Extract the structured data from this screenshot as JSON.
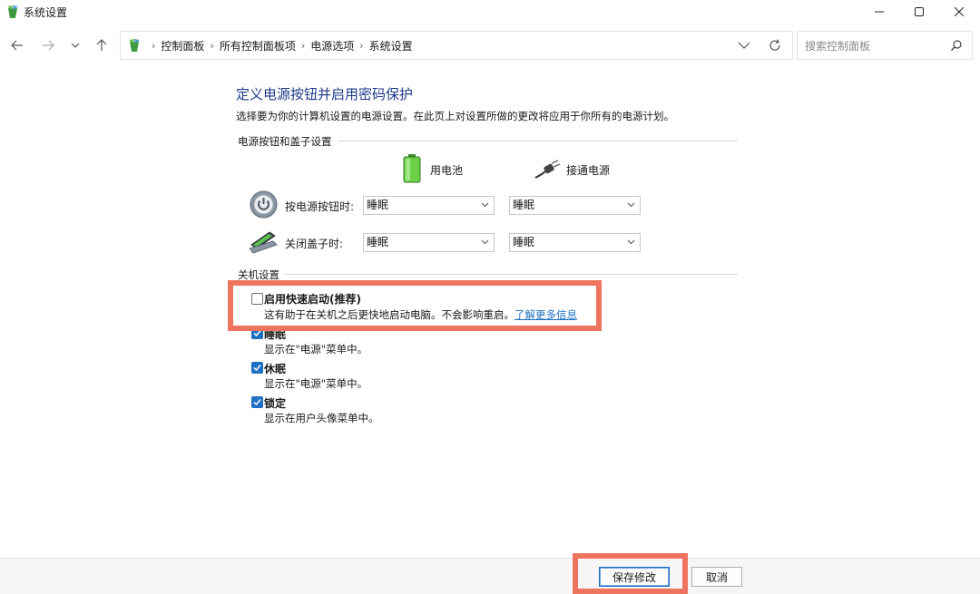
{
  "window": {
    "title": "系统设置",
    "controls": {
      "minimize": "minimize-icon",
      "maximize": "maximize-icon",
      "close": "close-icon"
    }
  },
  "nav": {
    "back_icon": "back-arrow-icon",
    "forward_icon": "forward-arrow-icon",
    "recent_icon": "chevron-down-icon",
    "up_icon": "up-arrow-icon"
  },
  "breadcrumb": [
    "控制面板",
    "所有控制面板项",
    "电源选项",
    "系统设置"
  ],
  "search": {
    "placeholder": "搜索控制面板"
  },
  "page": {
    "heading": "定义电源按钮并启用密码保护",
    "description": "选择要为你的计算机设置的电源设置。在此页上对设置所做的更改将应用于你所有的电源计划。"
  },
  "power_group": {
    "label": "电源按钮和盖子设置",
    "columns": {
      "battery": "用电池",
      "plugged": "接通电源"
    },
    "rows": [
      {
        "label": "按电源按钮时:",
        "battery": "睡眠",
        "plugged": "睡眠"
      },
      {
        "label": "关闭盖子时:",
        "battery": "睡眠",
        "plugged": "睡眠"
      }
    ]
  },
  "shutdown_group": {
    "label": "关机设置",
    "options": [
      {
        "title": "启用快速启动(推荐)",
        "desc": "这有助于在关机之后更快地启动电脑。不会影响重启。",
        "link": "了解更多信息",
        "checked": false
      },
      {
        "title": "睡眠",
        "desc": "显示在\"电源\"菜单中。",
        "checked": true
      },
      {
        "title": "休眠",
        "desc": "显示在\"电源\"菜单中。",
        "checked": true
      },
      {
        "title": "锁定",
        "desc": "显示在用户头像菜单中。",
        "checked": true
      }
    ]
  },
  "buttons": {
    "save": "保存修改",
    "cancel": "取消"
  },
  "colors": {
    "accent": "#1f6fc5",
    "heading": "#1e3a8a",
    "highlight": "#ef7460"
  }
}
